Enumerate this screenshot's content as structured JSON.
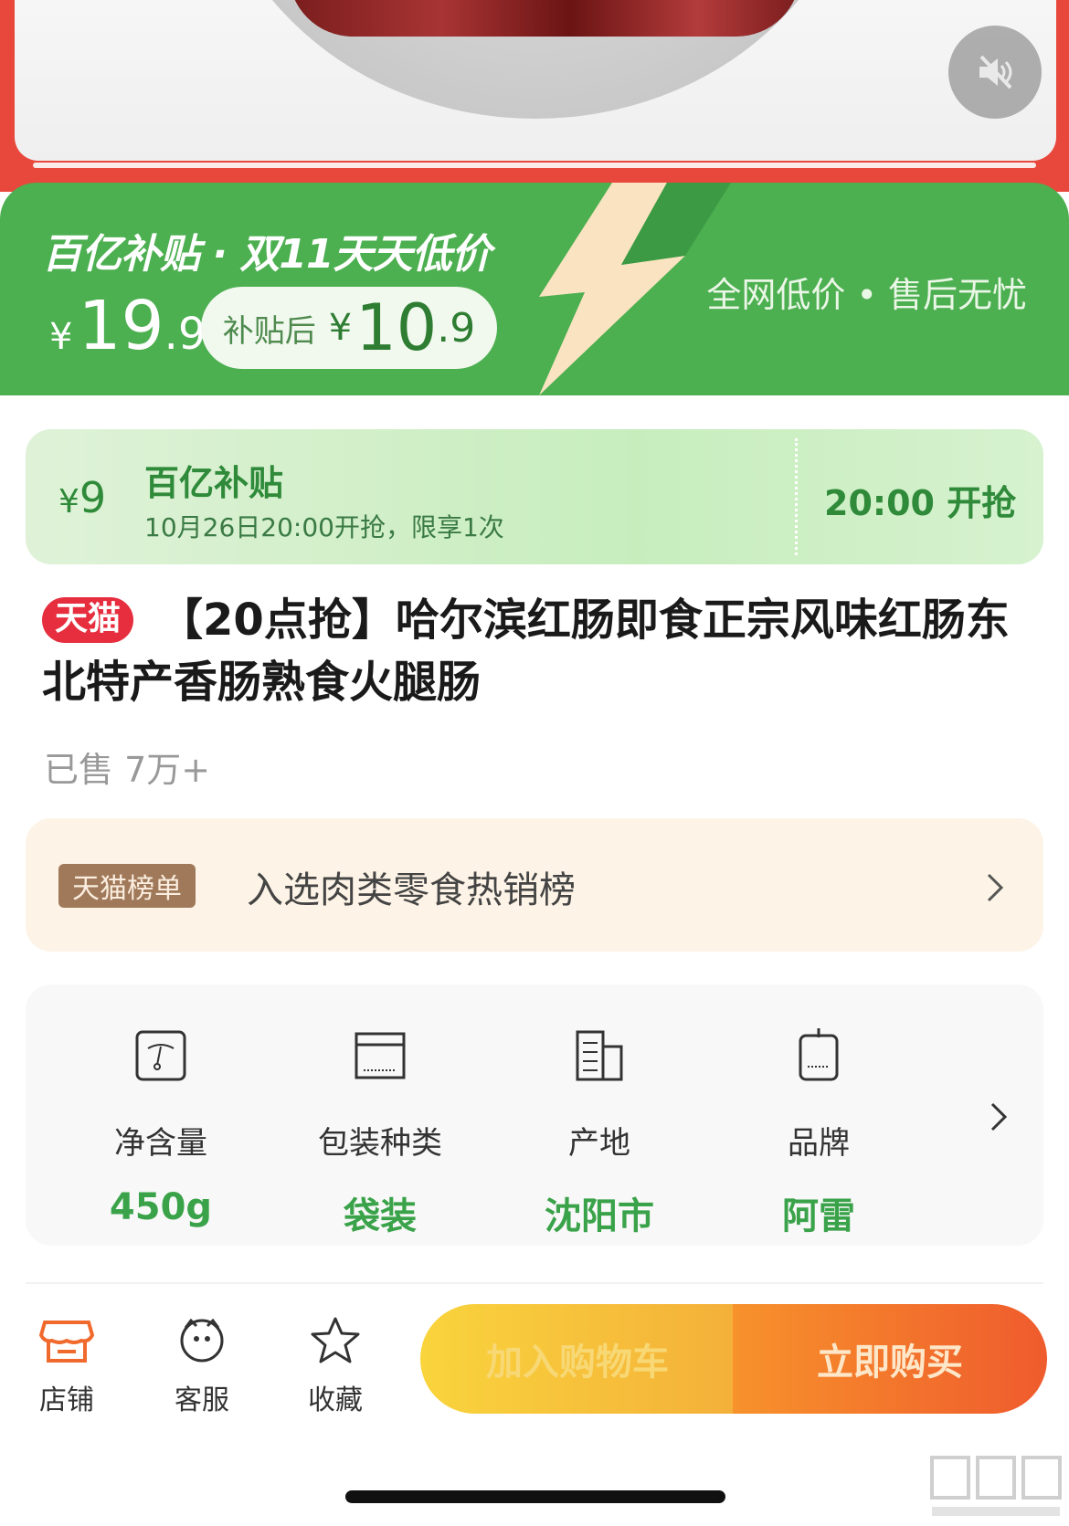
{
  "colors": {
    "brand_red": "#e8473c",
    "subsidy_green": "#4caf50",
    "tmall_red": "#e62e3f",
    "value_green": "#3aa34a",
    "buy_orange": "#ef5b2d",
    "cart_yellow": "#f4b03a"
  },
  "hero": {
    "mute_icon": "speaker-muted-icon"
  },
  "subsidy": {
    "title": "百亿补贴 · 双11天天低价",
    "price_symbol": "¥",
    "price_int": "19",
    "price_dec": ".9",
    "after_label": "补贴后",
    "after_symbol": "¥",
    "after_int": "10",
    "after_dec": ".9",
    "slogan": "全网低价 • 售后无忧"
  },
  "coupon": {
    "symbol": "¥",
    "amount": "9",
    "title": "百亿补贴",
    "desc": "10月26日20:00开抢，限享1次",
    "time": "20:00 开抢"
  },
  "product": {
    "badge": "天猫",
    "title": "【20点抢】哈尔滨红肠即食正宗风味红肠东北特产香肠熟食火腿肠",
    "sold": "已售 7万+"
  },
  "ranking": {
    "badge": "天猫榜单",
    "text": "入选肉类零食热销榜"
  },
  "attributes": [
    {
      "label": "净含量",
      "value": "450g",
      "icon": "scale-icon"
    },
    {
      "label": "包装种类",
      "value": "袋装",
      "icon": "package-box-icon"
    },
    {
      "label": "产地",
      "value": "沈阳市",
      "icon": "building-icon"
    },
    {
      "label": "品牌",
      "value": "阿雷",
      "icon": "brand-tag-icon"
    }
  ],
  "bottom_bar": {
    "store": "店铺",
    "service": "客服",
    "favorite": "收藏",
    "add_to_cart": "加入购物车",
    "buy_now": "立即购买"
  }
}
